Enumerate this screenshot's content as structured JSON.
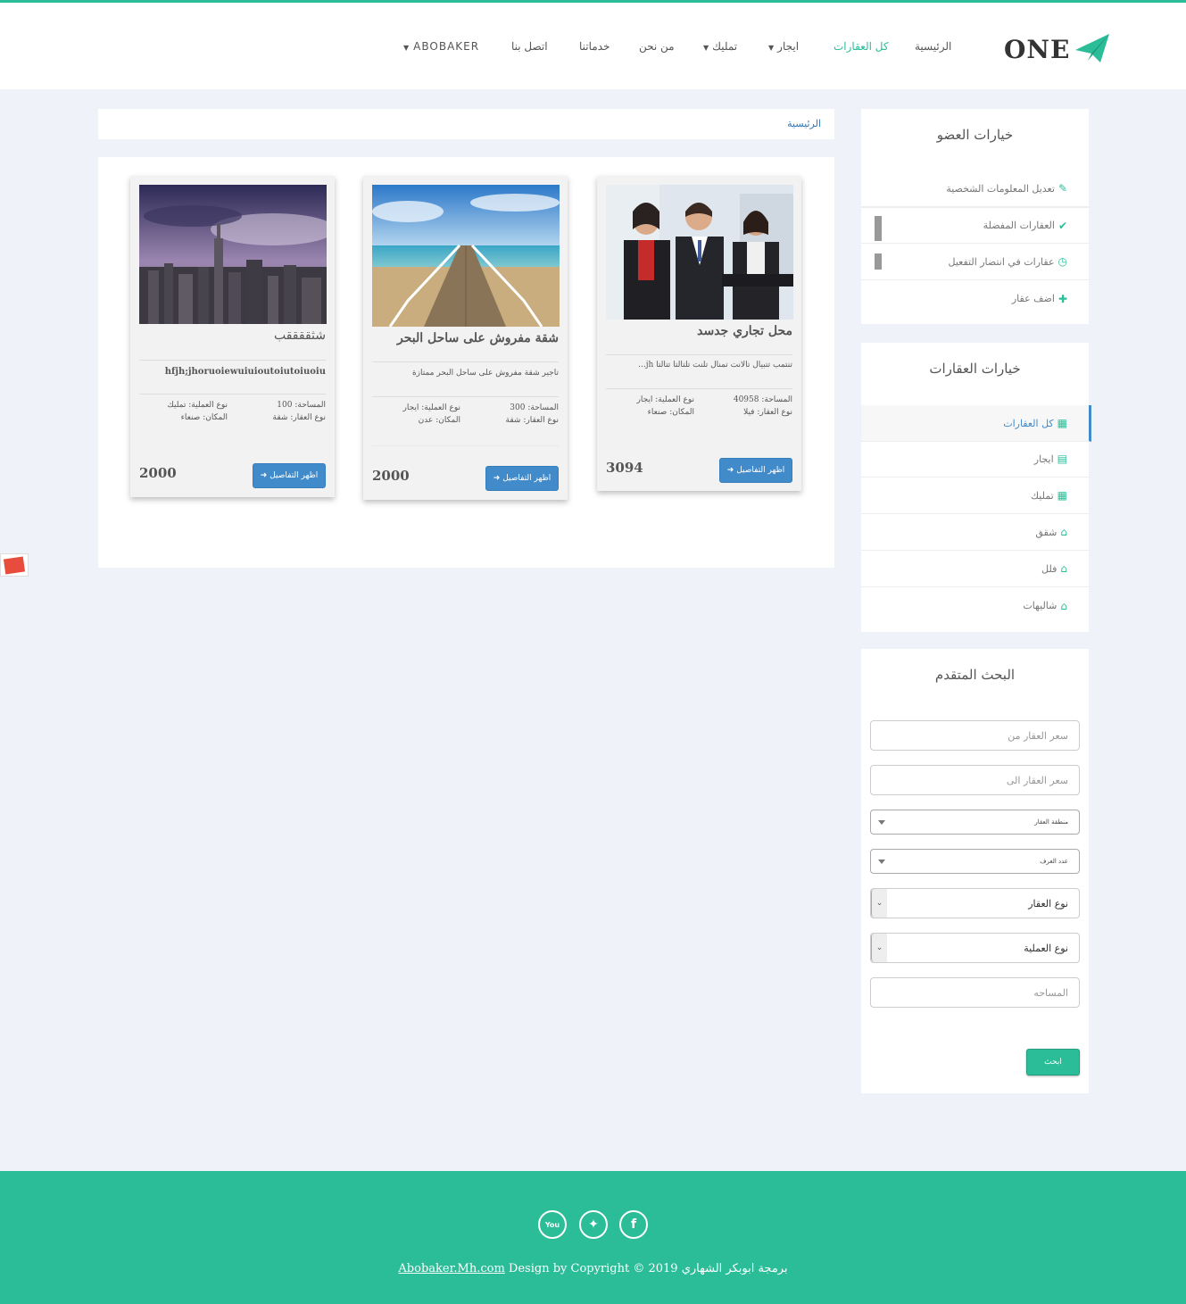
{
  "brand": {
    "logo_text": "ONE"
  },
  "nav": {
    "home": "الرئيسية",
    "all_properties": "كل العقارات",
    "rent": "ايجار",
    "ownership": "تمليك",
    "about": "من نحن",
    "services": "خدماتنا",
    "contact": "اتصل بنا",
    "user": "ABOBAKER"
  },
  "breadcrumb": {
    "home": "الرئيسية"
  },
  "cards": [
    {
      "title": "محل تجاري جدسد",
      "desc": "تنتمب تتبيال تالانت تمنال تلنت تلتالتا تتالتا jh...",
      "area_label": "المساحة:",
      "area": "40958",
      "deal_label": "نوع العملية:",
      "deal": "ايجار",
      "type_label": "نوع العقار:",
      "type": "فيلا",
      "place_label": "المكان:",
      "place": "صنعاء",
      "button": "اظهر التفاصيل",
      "price": "3094"
    },
    {
      "title": "شقة مفروش على ساحل البحر",
      "desc": "تاجير شقة مفروش على ساحل البحر ممتازة",
      "area_label": "المساحة:",
      "area": "300",
      "deal_label": "نوع العملية:",
      "deal": "ايجار",
      "type_label": "نوع العقار:",
      "type": "شقة",
      "place_label": "المكان:",
      "place": "عدن",
      "button": "اظهر التفاصيل",
      "price": "2000"
    },
    {
      "title": "شثققققب",
      "desc": "hfjh;jhoruoiewuiuioutoiutoiuoiu",
      "area_label": "المساحة:",
      "area": "100",
      "deal_label": "نوع العملية:",
      "deal": "تمليك",
      "type_label": "نوع العقار:",
      "type": "شقة",
      "place_label": "المكان:",
      "place": "صنعاء",
      "button": "اظهر التفاصيل",
      "price": "2000"
    }
  ],
  "member_panel": {
    "title": "خيارات العضو",
    "items": [
      "تعديل المعلومات الشخصية",
      "العقارات المفضلة",
      "عقارات في انتضار التفعيل",
      "اضف عقار"
    ]
  },
  "property_panel": {
    "title": "خيارات العقارات",
    "items": [
      "كل العقارات",
      "ايجار",
      "تمليك",
      "شقق",
      "فلل",
      "شاليهات"
    ]
  },
  "search_panel": {
    "title": "البحث المتقدم",
    "price_from": "سعر العقار من",
    "price_to": "سعر العقار الى",
    "region": "منطقة العقار",
    "rooms": "عدد الغرف",
    "property_type": "نوع العقار",
    "deal_type": "نوع العملية",
    "area": "المساحه",
    "button": "ابحث"
  },
  "footer": {
    "text": "Design by Copyright © 2019 برمجة ابوبكر الشهاري",
    "link": "Abobaker.Mh.com",
    "youtube": "You"
  },
  "colors": {
    "accent": "#2bbc98",
    "primary": "#428bca",
    "background": "#eff2f8"
  }
}
